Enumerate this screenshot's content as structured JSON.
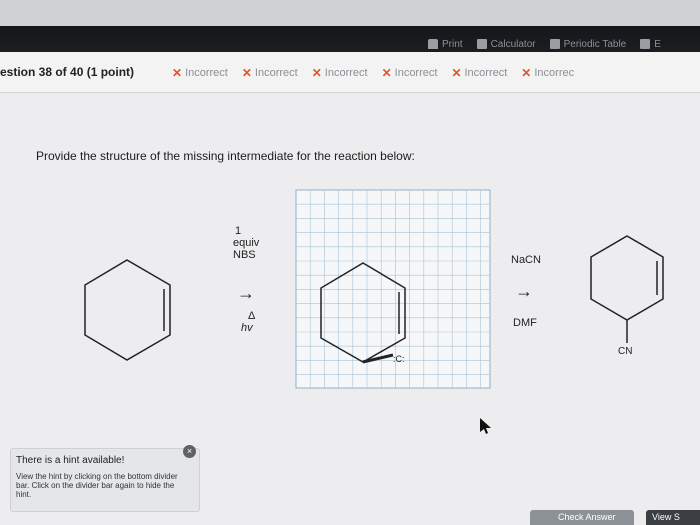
{
  "toolbar": {
    "links": [
      {
        "label": "Print",
        "icon": "print-icon"
      },
      {
        "label": "Calculator",
        "icon": "calculator-icon"
      },
      {
        "label": "Periodic Table",
        "icon": "periodic-table-icon"
      },
      {
        "label": "E",
        "icon": "ebook-icon"
      }
    ]
  },
  "question": {
    "title": "estion 38 of 40 (1 point)",
    "attempts": [
      "Incorrect",
      "Incorrect",
      "Incorrect",
      "Incorrect",
      "Incorrect",
      "Incorrec"
    ],
    "prompt": "Provide the structure of the missing intermediate for the reaction below:"
  },
  "reaction": {
    "step1": {
      "reagent_1": "1",
      "reagent_2": "equiv",
      "reagent_3": "NBS",
      "condition_1": "Δ",
      "condition_2": "hv",
      "arrow": "→"
    },
    "step2": {
      "reagent": "NaCN",
      "solvent": "DMF",
      "arrow": "→"
    },
    "product_label": "CN",
    "lone_pair_label": ":C:"
  },
  "hint": {
    "title": "There is a hint available!",
    "text": "View the hint by clicking on the bottom divider bar. Click on the divider bar again to hide the hint.",
    "close": "×"
  },
  "buttons": {
    "check_answer": "Check Answer",
    "view": "View S"
  },
  "colors": {
    "incorrect_x": "#e0552a",
    "top_bar": "#141619",
    "grid_line": "#a9c4d6"
  }
}
